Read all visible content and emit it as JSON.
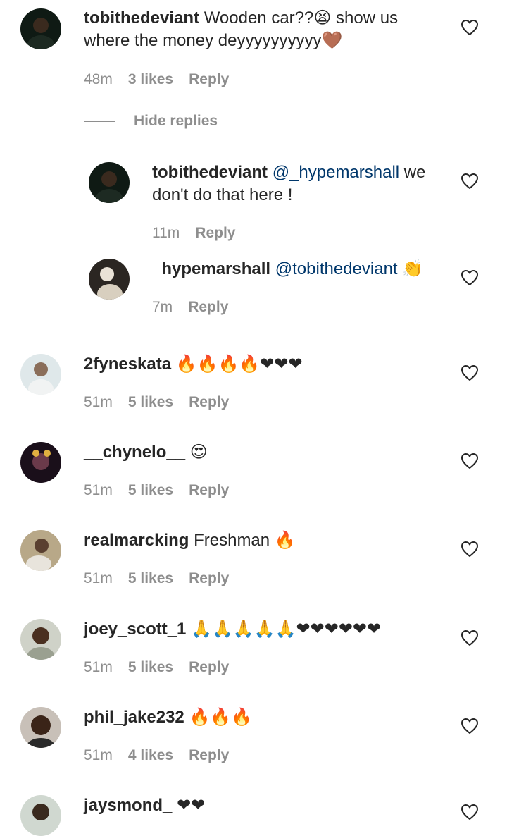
{
  "comments": [
    {
      "username": "tobithedeviant",
      "text": "Wooden car??😫 show us where the money deyyyyyyyyyy🤎",
      "time": "48m",
      "likes": "3 likes",
      "reply": "Reply"
    },
    {
      "username": "2fyneskata",
      "text": "🔥🔥🔥🔥❤❤❤",
      "time": "51m",
      "likes": "5 likes",
      "reply": "Reply"
    },
    {
      "username": "__chynelo__",
      "text": "😍",
      "time": "51m",
      "likes": "5 likes",
      "reply": "Reply"
    },
    {
      "username": "realmarcking",
      "text": "Freshman 🔥",
      "time": "51m",
      "likes": "5 likes",
      "reply": "Reply"
    },
    {
      "username": "joey_scott_1",
      "text": "🙏🙏🙏🙏🙏❤❤❤❤❤❤",
      "time": "51m",
      "likes": "5 likes",
      "reply": "Reply"
    },
    {
      "username": "phil_jake232",
      "text": "🔥🔥🔥",
      "time": "51m",
      "likes": "4 likes",
      "reply": "Reply"
    },
    {
      "username": "jaysmond_",
      "text": "❤❤"
    }
  ],
  "replies": [
    {
      "username": "tobithedeviant",
      "mention": "@_hypemarshall",
      "text": " we don't do that here !",
      "time": "11m",
      "reply": "Reply"
    },
    {
      "username": "_hypemarshall",
      "mention": "@tobithedeviant",
      "text": " 👏",
      "time": "7m",
      "reply": "Reply"
    }
  ],
  "hide_replies_label": "Hide replies",
  "colors": {
    "text": "#262626",
    "meta": "#8e8e8e",
    "mention": "#00376b"
  },
  "icons": {
    "like": "heart-outline-icon"
  }
}
